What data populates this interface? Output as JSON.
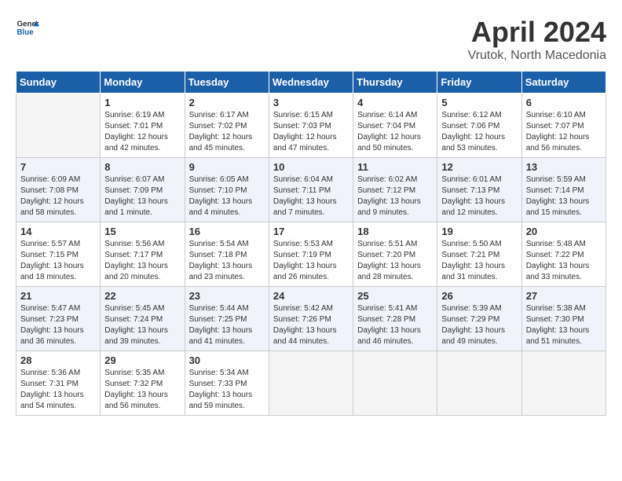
{
  "header": {
    "logo_general": "General",
    "logo_blue": "Blue",
    "title": "April 2024",
    "location": "Vrutok, North Macedonia"
  },
  "days_of_week": [
    "Sunday",
    "Monday",
    "Tuesday",
    "Wednesday",
    "Thursday",
    "Friday",
    "Saturday"
  ],
  "weeks": [
    [
      {
        "day": "",
        "empty": true
      },
      {
        "day": "1",
        "sunrise": "Sunrise: 6:19 AM",
        "sunset": "Sunset: 7:01 PM",
        "daylight": "Daylight: 12 hours and 42 minutes."
      },
      {
        "day": "2",
        "sunrise": "Sunrise: 6:17 AM",
        "sunset": "Sunset: 7:02 PM",
        "daylight": "Daylight: 12 hours and 45 minutes."
      },
      {
        "day": "3",
        "sunrise": "Sunrise: 6:15 AM",
        "sunset": "Sunset: 7:03 PM",
        "daylight": "Daylight: 12 hours and 47 minutes."
      },
      {
        "day": "4",
        "sunrise": "Sunrise: 6:14 AM",
        "sunset": "Sunset: 7:04 PM",
        "daylight": "Daylight: 12 hours and 50 minutes."
      },
      {
        "day": "5",
        "sunrise": "Sunrise: 6:12 AM",
        "sunset": "Sunset: 7:06 PM",
        "daylight": "Daylight: 12 hours and 53 minutes."
      },
      {
        "day": "6",
        "sunrise": "Sunrise: 6:10 AM",
        "sunset": "Sunset: 7:07 PM",
        "daylight": "Daylight: 12 hours and 56 minutes."
      }
    ],
    [
      {
        "day": "7",
        "sunrise": "Sunrise: 6:09 AM",
        "sunset": "Sunset: 7:08 PM",
        "daylight": "Daylight: 12 hours and 58 minutes."
      },
      {
        "day": "8",
        "sunrise": "Sunrise: 6:07 AM",
        "sunset": "Sunset: 7:09 PM",
        "daylight": "Daylight: 13 hours and 1 minute."
      },
      {
        "day": "9",
        "sunrise": "Sunrise: 6:05 AM",
        "sunset": "Sunset: 7:10 PM",
        "daylight": "Daylight: 13 hours and 4 minutes."
      },
      {
        "day": "10",
        "sunrise": "Sunrise: 6:04 AM",
        "sunset": "Sunset: 7:11 PM",
        "daylight": "Daylight: 13 hours and 7 minutes."
      },
      {
        "day": "11",
        "sunrise": "Sunrise: 6:02 AM",
        "sunset": "Sunset: 7:12 PM",
        "daylight": "Daylight: 13 hours and 9 minutes."
      },
      {
        "day": "12",
        "sunrise": "Sunrise: 6:01 AM",
        "sunset": "Sunset: 7:13 PM",
        "daylight": "Daylight: 13 hours and 12 minutes."
      },
      {
        "day": "13",
        "sunrise": "Sunrise: 5:59 AM",
        "sunset": "Sunset: 7:14 PM",
        "daylight": "Daylight: 13 hours and 15 minutes."
      }
    ],
    [
      {
        "day": "14",
        "sunrise": "Sunrise: 5:57 AM",
        "sunset": "Sunset: 7:15 PM",
        "daylight": "Daylight: 13 hours and 18 minutes."
      },
      {
        "day": "15",
        "sunrise": "Sunrise: 5:56 AM",
        "sunset": "Sunset: 7:17 PM",
        "daylight": "Daylight: 13 hours and 20 minutes."
      },
      {
        "day": "16",
        "sunrise": "Sunrise: 5:54 AM",
        "sunset": "Sunset: 7:18 PM",
        "daylight": "Daylight: 13 hours and 23 minutes."
      },
      {
        "day": "17",
        "sunrise": "Sunrise: 5:53 AM",
        "sunset": "Sunset: 7:19 PM",
        "daylight": "Daylight: 13 hours and 26 minutes."
      },
      {
        "day": "18",
        "sunrise": "Sunrise: 5:51 AM",
        "sunset": "Sunset: 7:20 PM",
        "daylight": "Daylight: 13 hours and 28 minutes."
      },
      {
        "day": "19",
        "sunrise": "Sunrise: 5:50 AM",
        "sunset": "Sunset: 7:21 PM",
        "daylight": "Daylight: 13 hours and 31 minutes."
      },
      {
        "day": "20",
        "sunrise": "Sunrise: 5:48 AM",
        "sunset": "Sunset: 7:22 PM",
        "daylight": "Daylight: 13 hours and 33 minutes."
      }
    ],
    [
      {
        "day": "21",
        "sunrise": "Sunrise: 5:47 AM",
        "sunset": "Sunset: 7:23 PM",
        "daylight": "Daylight: 13 hours and 36 minutes."
      },
      {
        "day": "22",
        "sunrise": "Sunrise: 5:45 AM",
        "sunset": "Sunset: 7:24 PM",
        "daylight": "Daylight: 13 hours and 39 minutes."
      },
      {
        "day": "23",
        "sunrise": "Sunrise: 5:44 AM",
        "sunset": "Sunset: 7:25 PM",
        "daylight": "Daylight: 13 hours and 41 minutes."
      },
      {
        "day": "24",
        "sunrise": "Sunrise: 5:42 AM",
        "sunset": "Sunset: 7:26 PM",
        "daylight": "Daylight: 13 hours and 44 minutes."
      },
      {
        "day": "25",
        "sunrise": "Sunrise: 5:41 AM",
        "sunset": "Sunset: 7:28 PM",
        "daylight": "Daylight: 13 hours and 46 minutes."
      },
      {
        "day": "26",
        "sunrise": "Sunrise: 5:39 AM",
        "sunset": "Sunset: 7:29 PM",
        "daylight": "Daylight: 13 hours and 49 minutes."
      },
      {
        "day": "27",
        "sunrise": "Sunrise: 5:38 AM",
        "sunset": "Sunset: 7:30 PM",
        "daylight": "Daylight: 13 hours and 51 minutes."
      }
    ],
    [
      {
        "day": "28",
        "sunrise": "Sunrise: 5:36 AM",
        "sunset": "Sunset: 7:31 PM",
        "daylight": "Daylight: 13 hours and 54 minutes."
      },
      {
        "day": "29",
        "sunrise": "Sunrise: 5:35 AM",
        "sunset": "Sunset: 7:32 PM",
        "daylight": "Daylight: 13 hours and 56 minutes."
      },
      {
        "day": "30",
        "sunrise": "Sunrise: 5:34 AM",
        "sunset": "Sunset: 7:33 PM",
        "daylight": "Daylight: 13 hours and 59 minutes."
      },
      {
        "day": "",
        "empty": true
      },
      {
        "day": "",
        "empty": true
      },
      {
        "day": "",
        "empty": true
      },
      {
        "day": "",
        "empty": true
      }
    ]
  ]
}
